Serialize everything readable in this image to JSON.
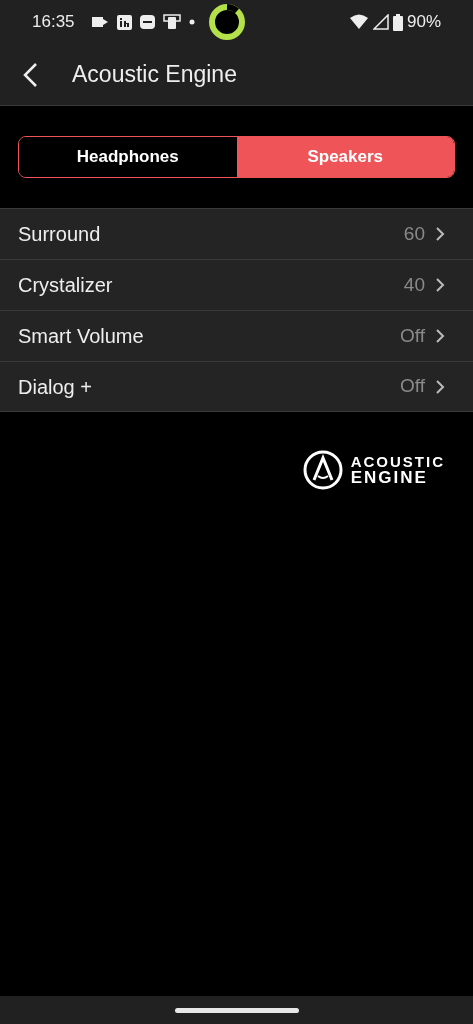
{
  "status_bar": {
    "time": "16:35",
    "battery": "90%"
  },
  "header": {
    "title": "Acoustic Engine"
  },
  "tabs": [
    {
      "label": "Headphones",
      "selected": false
    },
    {
      "label": "Speakers",
      "selected": true
    }
  ],
  "settings": [
    {
      "label": "Surround",
      "value": "60"
    },
    {
      "label": "Crystalizer",
      "value": "40"
    },
    {
      "label": "Smart Volume",
      "value": "Off"
    },
    {
      "label": "Dialog +",
      "value": "Off"
    }
  ],
  "logo": {
    "lines": [
      "ACOUSTIC",
      "ENGINE"
    ]
  }
}
